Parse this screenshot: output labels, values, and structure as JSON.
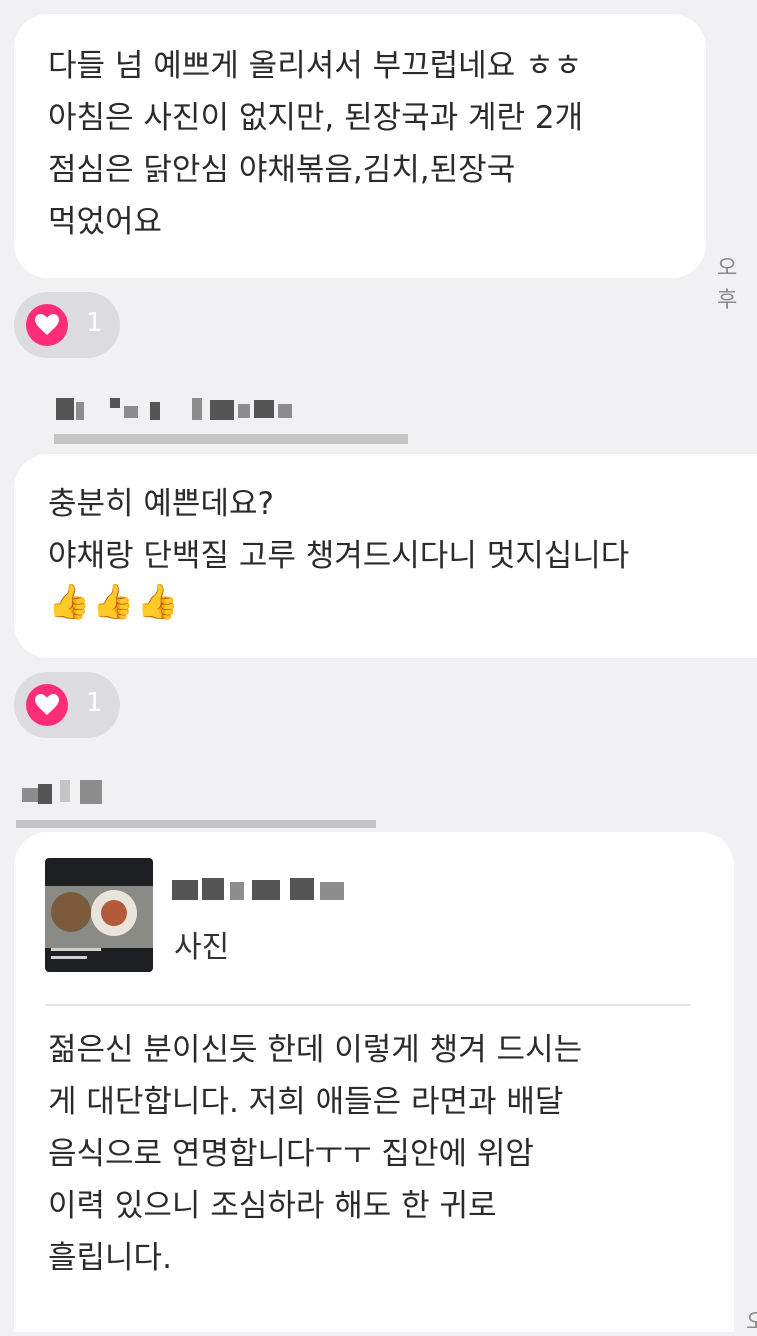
{
  "messages": [
    {
      "text": "다들 넘 예쁘게 올리셔서 부끄럽네요 ㅎㅎ\n아침은 사진이 없지만, 된장국과 계란 2개\n점심은 닭안심 야채볶음,김치,된장국\n먹었어요",
      "time": "오후",
      "reaction_count": "1"
    },
    {
      "text": "충분히 예쁜데요?\n야채랑 단백질 고루 챙겨드시다니 멋지십니다",
      "emoji": "👍👍👍",
      "reaction_count": "1"
    },
    {
      "quote_label": "사진",
      "text": "젊은신 분이신듯 한데 이렇게 챙겨 드시는\n게 대단합니다. 저희 애들은 라면과 배달\n음식으로 연명합니다ㅜㅜ 집안에 위암\n이력 있으니 조심하라 해도 한 귀로\n흘립니다.",
      "time": "오"
    }
  ],
  "colors": {
    "background": "#f1f1f3",
    "bubble": "#ffffff",
    "heart": "#ff2d78",
    "reaction_pill": "#dcdcdf"
  },
  "icons": [
    "heart-icon",
    "thumbs-up-emoji"
  ]
}
